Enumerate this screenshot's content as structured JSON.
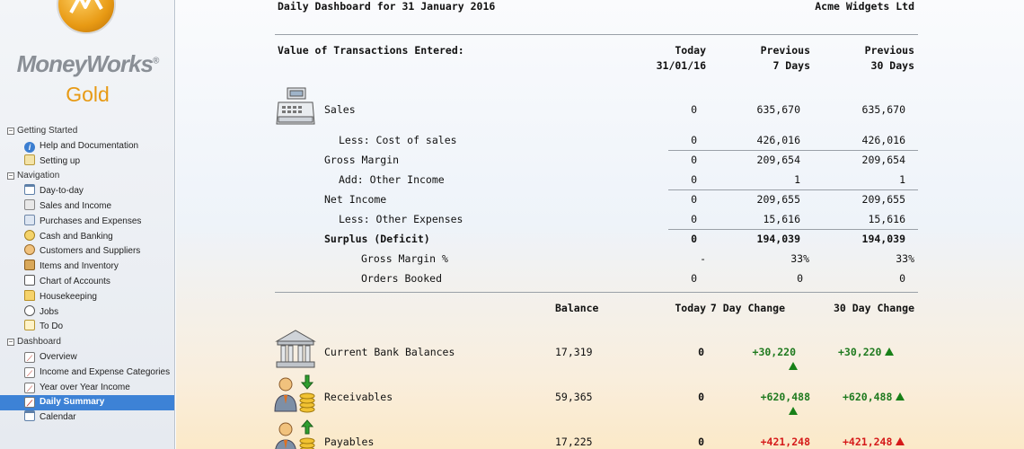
{
  "sidebar": {
    "logo_name": "MoneyWorks",
    "logo_mark": "®",
    "edition": "Gold",
    "groups": [
      {
        "label": "Getting Started",
        "toggle": "−",
        "items": [
          {
            "label": "Help and Documentation",
            "icon": "info-icon"
          },
          {
            "label": "Setting up",
            "icon": "gear-icon"
          }
        ]
      },
      {
        "label": "Navigation",
        "toggle": "−",
        "items": [
          {
            "label": "Day-to-day",
            "icon": "calendar-icon"
          },
          {
            "label": "Sales and Income",
            "icon": "register-icon"
          },
          {
            "label": "Purchases and Expenses",
            "icon": "purchase-icon"
          },
          {
            "label": "Cash and Banking",
            "icon": "cash-icon"
          },
          {
            "label": "Customers and Suppliers",
            "icon": "people-icon"
          },
          {
            "label": "Items and Inventory",
            "icon": "box-icon"
          },
          {
            "label": "Chart of Accounts",
            "icon": "book-icon"
          },
          {
            "label": "Housekeeping",
            "icon": "folder-icon"
          },
          {
            "label": "Jobs",
            "icon": "stopwatch-icon"
          },
          {
            "label": "To Do",
            "icon": "todo-icon"
          }
        ]
      },
      {
        "label": "Dashboard",
        "toggle": "−",
        "items": [
          {
            "label": "Overview",
            "icon": "chart-icon"
          },
          {
            "label": "Income and Expense Categories",
            "icon": "chart-icon"
          },
          {
            "label": "Year over Year Income",
            "icon": "chart-icon"
          },
          {
            "label": "Daily Summary",
            "icon": "chart-icon",
            "selected": true
          },
          {
            "label": "Calendar",
            "icon": "calendar-icon"
          }
        ]
      }
    ]
  },
  "dashboard": {
    "title": "Daily Dashboard for 31 January 2016",
    "company": "Acme Widgets Ltd",
    "section1": {
      "heading": "Value of Transactions Entered:",
      "col_today_line1": "Today",
      "col_today_line2": "31/01/16",
      "col_prev7_line1": "Previous",
      "col_prev7_line2": "7 Days",
      "col_prev30_line1": "Previous",
      "col_prev30_line2": "30 Days",
      "rows": {
        "sales": {
          "label": "Sales",
          "today": "0",
          "prev7": "635,670",
          "prev30": "635,670"
        },
        "cost_of_sales": {
          "label": "Less: Cost of sales",
          "today": "0",
          "prev7": "426,016",
          "prev30": "426,016"
        },
        "gross_margin": {
          "label": "Gross Margin",
          "today": "0",
          "prev7": "209,654",
          "prev30": "209,654"
        },
        "other_income": {
          "label": "Add: Other Income",
          "today": "0",
          "prev7": "1",
          "prev30": "1"
        },
        "net_income": {
          "label": "Net Income",
          "today": "0",
          "prev7": "209,655",
          "prev30": "209,655"
        },
        "other_expenses": {
          "label": "Less: Other Expenses",
          "today": "0",
          "prev7": "15,616",
          "prev30": "15,616"
        },
        "surplus": {
          "label": "Surplus (Deficit)",
          "today": "0",
          "prev7": "194,039",
          "prev30": "194,039"
        },
        "gm_percent": {
          "label": "Gross Margin %",
          "today": "-",
          "prev7": "33%",
          "prev30": "33%"
        },
        "orders": {
          "label": "Orders Booked",
          "today": "0",
          "prev7": "0",
          "prev30": "0"
        }
      }
    },
    "section2": {
      "col_balance": "Balance",
      "col_today": "Today",
      "col_7day": "7 Day Change",
      "col_30day": "30 Day Change",
      "rows": {
        "bank": {
          "label": "Current Bank Balances",
          "balance": "17,319",
          "today": "0",
          "change7": "+30,220",
          "change30": "+30,220",
          "trend": "up"
        },
        "receivables": {
          "label": "Receivables",
          "balance": "59,365",
          "today": "0",
          "change7": "+620,488",
          "change30": "+620,488",
          "trend": "up"
        },
        "payables": {
          "label": "Payables",
          "balance": "17,225",
          "today": "0",
          "change7": "+421,248",
          "change30": "+421,248",
          "trend": "up"
        }
      }
    }
  },
  "colors": {
    "selected": "#3d82d6",
    "positive": "#1f7a1f",
    "negative": "#d51a1a",
    "logo_gold": "#e79a14"
  }
}
